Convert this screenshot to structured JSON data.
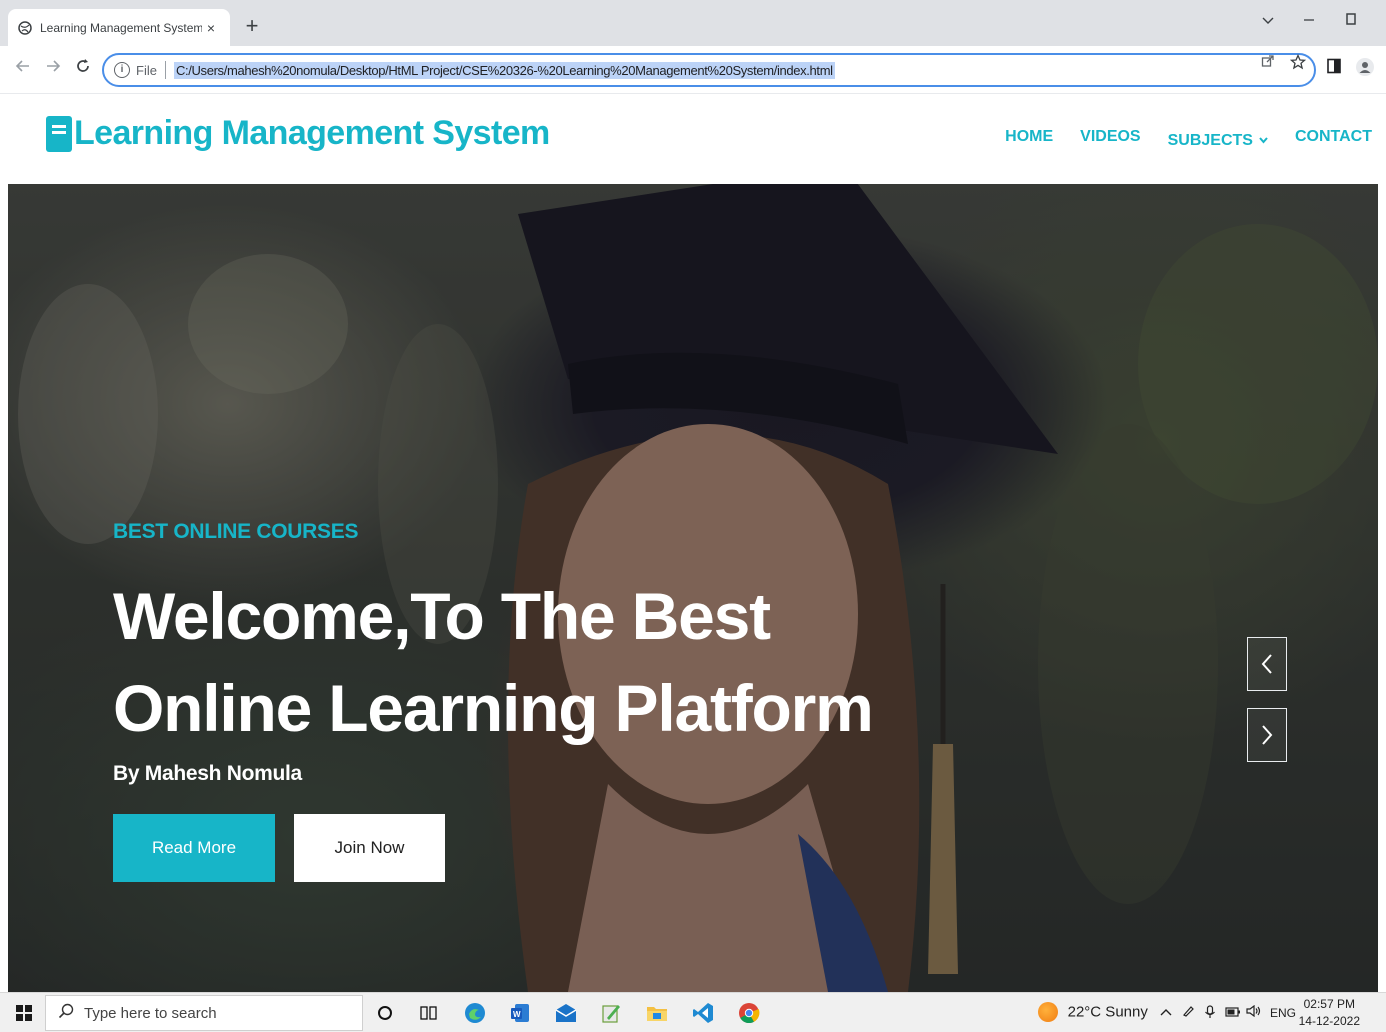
{
  "browser": {
    "tab_title": "Learning Management System",
    "tab_close": "×",
    "new_tab": "+",
    "url_scheme": "File",
    "url": "C:/Users/mahesh%20nomula/Desktop/HtML Project/CSE%20326-%20Learning%20Management%20System/index.html"
  },
  "site": {
    "brand": "Learning Management System",
    "nav": [
      {
        "label": "HOME"
      },
      {
        "label": "VIDEOS"
      },
      {
        "label": "SUBJECTS"
      },
      {
        "label": "CONTACT"
      }
    ]
  },
  "hero": {
    "eyebrow": "BEST ONLINE COURSES",
    "title_line1": "Welcome,To The Best",
    "title_line2": "Online Learning Platform",
    "byline": "By Mahesh Nomula",
    "primary_button": "Read More",
    "secondary_button": "Join Now"
  },
  "taskbar": {
    "search_placeholder": "Type here to search",
    "weather": "22°C  Sunny",
    "language": "ENG",
    "time": "02:57 PM",
    "date": "14-12-2022"
  },
  "colors": {
    "accent": "#17b5c8",
    "omnibox_border": "#4a8ee8"
  }
}
